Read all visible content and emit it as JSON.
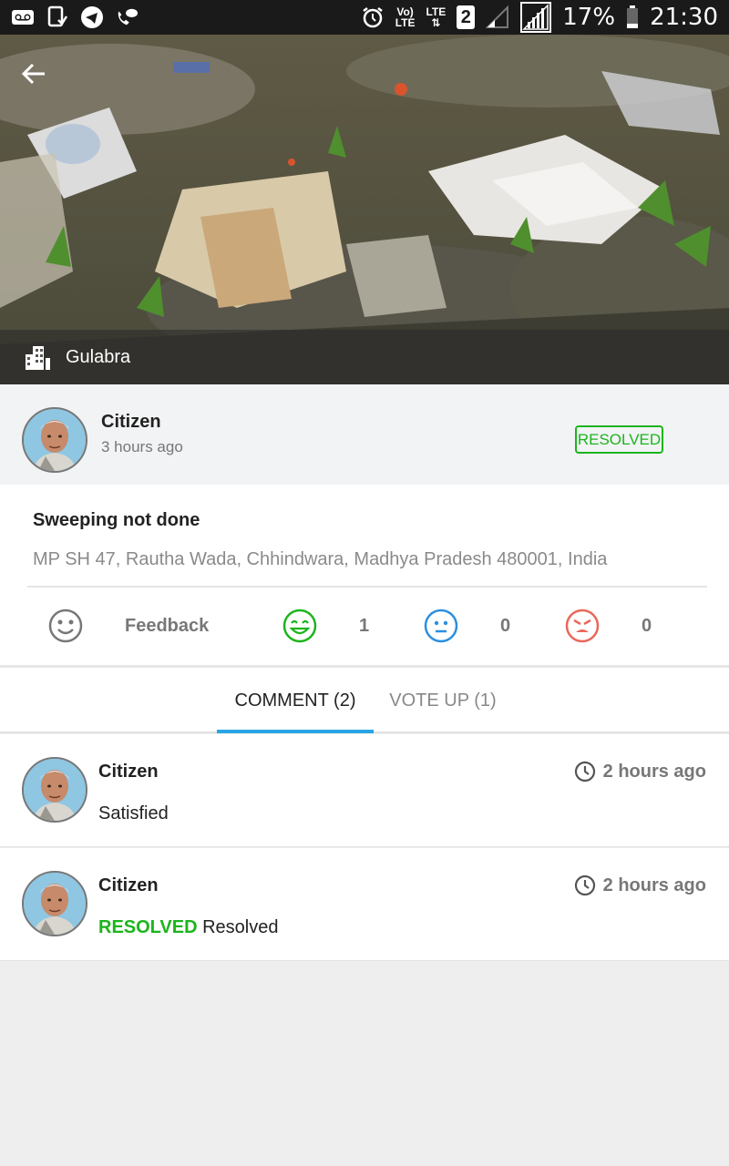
{
  "status_bar": {
    "battery": "17%",
    "time": "21:30",
    "volte_line1": "Vo)",
    "volte_line2": "LTE",
    "lte": "LTE",
    "sim": "2"
  },
  "hero": {
    "location": "Gulabra"
  },
  "reporter": {
    "name": "Citizen",
    "time": "3 hours ago",
    "status": "RESOLVED"
  },
  "complaint": {
    "title": "Sweeping not done",
    "address": "MP SH 47, Rautha Wada, Chhindwara, Madhya Pradesh 480001, India"
  },
  "feedback": {
    "label": "Feedback",
    "happy_count": "1",
    "neutral_count": "0",
    "angry_count": "0"
  },
  "tabs": {
    "comment": "COMMENT (2)",
    "vote_up": "VOTE UP (1)"
  },
  "comments": [
    {
      "name": "Citizen",
      "time": "2 hours ago",
      "status": "",
      "text": "Satisfied"
    },
    {
      "name": "Citizen",
      "time": "2 hours ago",
      "status": "RESOLVED",
      "text": "Resolved"
    }
  ],
  "colors": {
    "accent": "#29a4e4",
    "resolved": "#1bb51b",
    "happy": "#1bb51b",
    "neutral": "#2b8fe0",
    "angry": "#e9675a"
  }
}
